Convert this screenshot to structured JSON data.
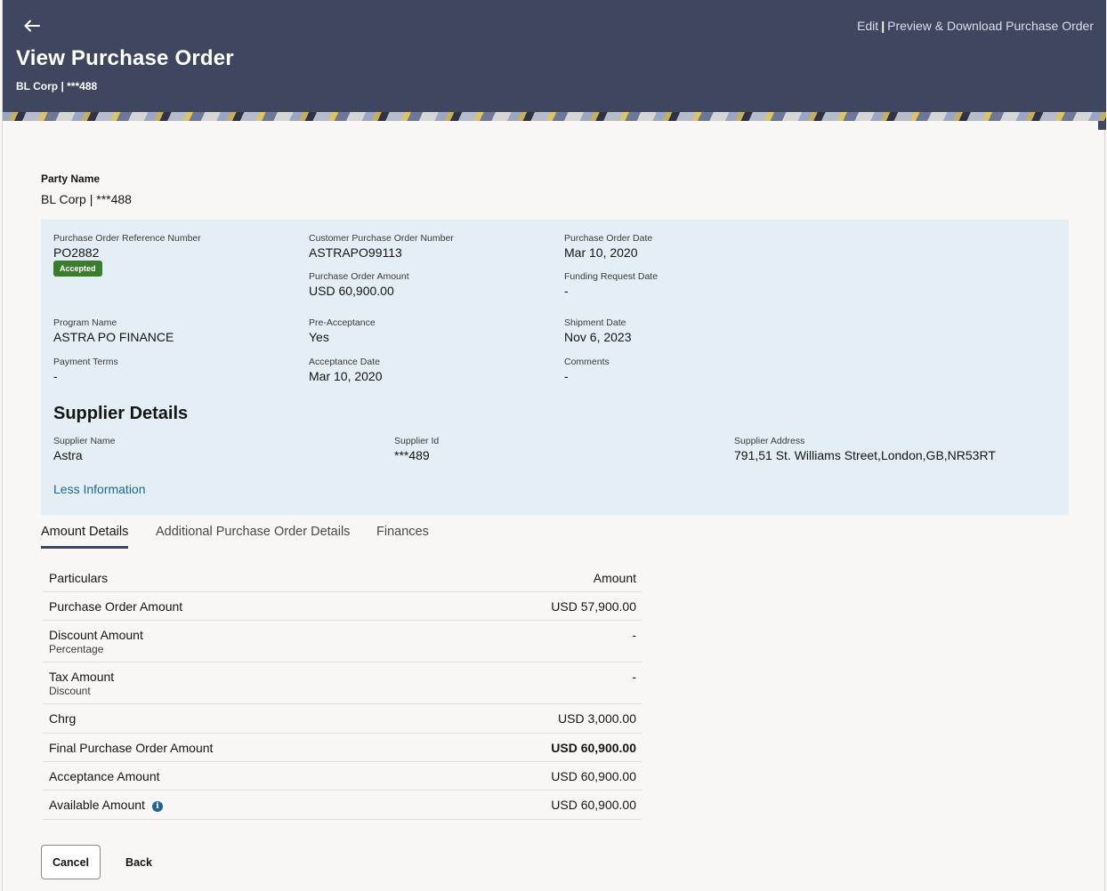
{
  "header": {
    "title": "View Purchase Order",
    "subtitle": "BL Corp | ***488",
    "links": {
      "edit": "Edit",
      "separator": "|",
      "preview": "Preview & Download Purchase Order"
    }
  },
  "party": {
    "label": "Party Name",
    "value": "BL Corp | ***488"
  },
  "details": {
    "po_ref": {
      "label": "Purchase Order Reference Number",
      "value": "PO2882",
      "status": "Accepted"
    },
    "customer_po": {
      "label": "Customer Purchase Order Number",
      "value": "ASTRAPO99113"
    },
    "po_date": {
      "label": "Purchase Order Date",
      "value": "Mar 10, 2020"
    },
    "po_amount": {
      "label": "Purchase Order Amount",
      "value": "USD 60,900.00"
    },
    "funding_date": {
      "label": "Funding Request Date",
      "value": "-"
    },
    "program": {
      "label": "Program Name",
      "value": "ASTRA PO FINANCE"
    },
    "pre_acceptance": {
      "label": "Pre-Acceptance",
      "value": "Yes"
    },
    "shipment_date": {
      "label": "Shipment Date",
      "value": "Nov 6, 2023"
    },
    "payment_terms": {
      "label": "Payment Terms",
      "value": "-"
    },
    "acceptance_date": {
      "label": "Acceptance Date",
      "value": "Mar 10, 2020"
    },
    "comments": {
      "label": "Comments",
      "value": "-"
    }
  },
  "supplier": {
    "heading": "Supplier Details",
    "name": {
      "label": "Supplier Name",
      "value": "Astra"
    },
    "id": {
      "label": "Supplier Id",
      "value": "***489"
    },
    "address": {
      "label": "Supplier Address",
      "value": "791,51 St. Williams Street,London,GB,NR53RT"
    },
    "toggle_link": "Less Information"
  },
  "tabs": [
    {
      "label": "Amount Details",
      "active": true
    },
    {
      "label": "Additional Purchase Order Details",
      "active": false
    },
    {
      "label": "Finances",
      "active": false
    }
  ],
  "amount_table": {
    "headers": {
      "particulars": "Particulars",
      "amount": "Amount"
    },
    "rows": [
      {
        "particular": "Purchase Order Amount",
        "sub": "",
        "amount": "USD 57,900.00"
      },
      {
        "particular": "Discount Amount",
        "sub": "Percentage",
        "amount": "-"
      },
      {
        "particular": "Tax Amount",
        "sub": "Discount",
        "amount": "-"
      },
      {
        "particular": "Chrg",
        "sub": "",
        "amount": "USD 3,000.00"
      },
      {
        "particular": "Final Purchase Order Amount",
        "sub": "",
        "amount": "USD 60,900.00"
      },
      {
        "particular": "Acceptance Amount",
        "sub": "",
        "amount": "USD 60,900.00"
      },
      {
        "particular": "Available Amount",
        "sub": "",
        "amount": "USD 60,900.00"
      }
    ]
  },
  "buttons": {
    "cancel": "Cancel",
    "back": "Back"
  },
  "colors": {
    "header_bg": "#3f4660",
    "panel_bg": "#e3eff5",
    "badge_green": "#3a7d2c",
    "link_blue": "#1f6593"
  },
  "icons": {
    "back": "arrow-left",
    "info": "info-circle"
  }
}
